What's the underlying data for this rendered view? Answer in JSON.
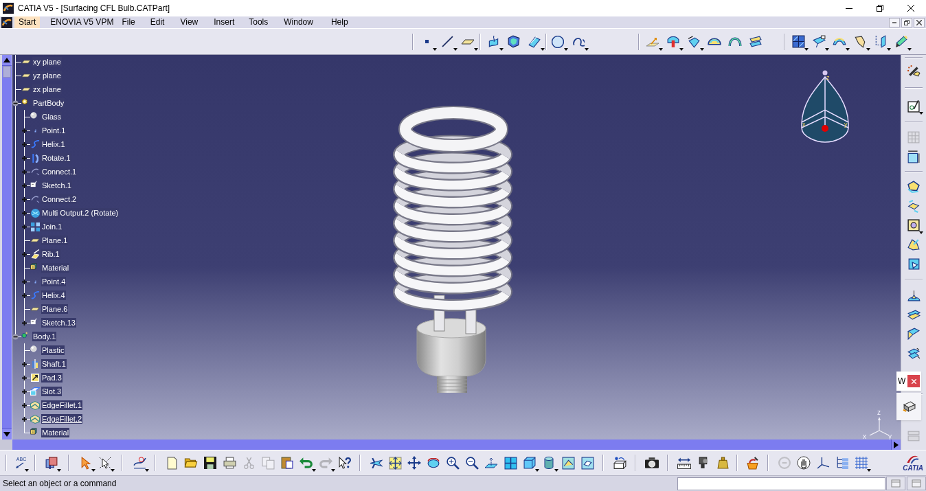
{
  "window": {
    "title": "CATIA V5 - [Surfacing CFL Bulb.CATPart]"
  },
  "menu_bar": {
    "items": [
      {
        "label": "Start",
        "selected": true
      },
      {
        "label": "ENOVIA V5 VPM",
        "selected": false
      },
      {
        "label": "File",
        "selected": false
      },
      {
        "label": "Edit",
        "selected": false
      },
      {
        "label": "View",
        "selected": false
      },
      {
        "label": "Insert",
        "selected": false
      },
      {
        "label": "Tools",
        "selected": false
      },
      {
        "label": "Window",
        "selected": false
      },
      {
        "label": "Help",
        "selected": false
      }
    ]
  },
  "top_toolbar": {
    "groups": [
      [
        {
          "kind": "point",
          "dropdown": true,
          "disabled": false
        },
        {
          "kind": "line",
          "dropdown": true,
          "disabled": false
        },
        {
          "kind": "plane",
          "dropdown": true,
          "disabled": false
        }
      ],
      [
        {
          "kind": "sweep",
          "dropdown": true,
          "disabled": false
        },
        {
          "kind": "patch",
          "dropdown": false,
          "disabled": false
        },
        {
          "kind": "extrude",
          "dropdown": true,
          "disabled": false
        }
      ],
      [
        {
          "kind": "circle",
          "dropdown": true,
          "disabled": false
        },
        {
          "kind": "spline",
          "dropdown": true,
          "disabled": false
        }
      ],
      [
        {
          "kind": "offset",
          "dropdown": true,
          "disabled": false
        },
        {
          "kind": "split",
          "dropdown": true,
          "disabled": false
        },
        {
          "kind": "flip",
          "dropdown": true,
          "disabled": false
        },
        {
          "kind": "dome",
          "dropdown": false,
          "disabled": false
        },
        {
          "kind": "arch",
          "dropdown": false,
          "disabled": false
        },
        {
          "kind": "stack",
          "dropdown": false,
          "disabled": false
        }
      ],
      [
        {
          "kind": "quad",
          "dropdown": true,
          "disabled": false
        },
        {
          "kind": "wedge",
          "dropdown": true,
          "disabled": false
        },
        {
          "kind": "arc",
          "dropdown": true,
          "disabled": false
        },
        {
          "kind": "bend",
          "dropdown": true,
          "disabled": false
        },
        {
          "kind": "project",
          "dropdown": true,
          "disabled": false
        },
        {
          "kind": "pencil",
          "dropdown": true,
          "disabled": false
        }
      ]
    ]
  },
  "specification_tree": [
    {
      "label": "xy plane",
      "kind": "plane",
      "expandable": false,
      "in_work": false
    },
    {
      "label": "yz plane",
      "kind": "plane",
      "expandable": false,
      "in_work": false
    },
    {
      "label": "zx plane",
      "kind": "plane",
      "expandable": false,
      "in_work": false
    },
    {
      "label": "PartBody",
      "kind": "body",
      "expandable": true,
      "expanded": true,
      "in_work": false,
      "children": [
        {
          "label": "Glass",
          "kind": "sphere",
          "expandable": false,
          "in_work": false
        },
        {
          "label": "Point.1",
          "kind": "point",
          "expandable": true,
          "expanded": false,
          "in_work": false
        },
        {
          "label": "Helix.1",
          "kind": "helix",
          "expandable": true,
          "expanded": false,
          "in_work": false
        },
        {
          "label": "Rotate.1",
          "kind": "rotate",
          "expandable": true,
          "expanded": false,
          "in_work": false
        },
        {
          "label": "Connect.1",
          "kind": "connect",
          "expandable": true,
          "expanded": false,
          "in_work": false
        },
        {
          "label": "Sketch.1",
          "kind": "sketch",
          "expandable": true,
          "expanded": false,
          "in_work": false
        },
        {
          "label": "Connect.2",
          "kind": "connect",
          "expandable": true,
          "expanded": false,
          "in_work": false
        },
        {
          "label": "Multi Output.2 (Rotate)",
          "kind": "multi",
          "expandable": true,
          "expanded": false,
          "in_work": false
        },
        {
          "label": "Join.1",
          "kind": "join",
          "expandable": true,
          "expanded": false,
          "in_work": false
        },
        {
          "label": "Plane.1",
          "kind": "plane",
          "expandable": false,
          "in_work": false
        },
        {
          "label": "Rib.1",
          "kind": "rib",
          "expandable": true,
          "expanded": false,
          "in_work": false
        },
        {
          "label": "Material",
          "kind": "material",
          "expandable": false,
          "in_work": false
        },
        {
          "label": "Point.4",
          "kind": "point",
          "expandable": true,
          "expanded": false,
          "in_work": false
        },
        {
          "label": "Helix.4",
          "kind": "helix",
          "expandable": true,
          "expanded": false,
          "in_work": false
        },
        {
          "label": "Plane.6",
          "kind": "plane",
          "expandable": false,
          "in_work": false
        },
        {
          "label": "Sketch.13",
          "kind": "sketch",
          "expandable": true,
          "expanded": false,
          "in_work": false
        }
      ]
    },
    {
      "label": "Body.1",
      "kind": "body_alt",
      "expandable": true,
      "expanded": true,
      "in_work": false,
      "children": [
        {
          "label": "Plastic",
          "kind": "sphere",
          "expandable": false,
          "in_work": false
        },
        {
          "label": "Shaft.1",
          "kind": "shaft",
          "expandable": true,
          "expanded": false,
          "in_work": false
        },
        {
          "label": "Pad.3",
          "kind": "pad",
          "expandable": true,
          "expanded": false,
          "in_work": false
        },
        {
          "label": "Slot.3",
          "kind": "slot",
          "expandable": true,
          "expanded": false,
          "in_work": false
        },
        {
          "label": "EdgeFillet.1",
          "kind": "fillet",
          "expandable": true,
          "expanded": false,
          "in_work": false
        },
        {
          "label": "EdgeFillet.2",
          "kind": "fillet",
          "expandable": true,
          "expanded": false,
          "in_work": true
        },
        {
          "label": "Material",
          "kind": "material",
          "expandable": false,
          "in_work": false
        }
      ]
    }
  ],
  "viewport": {
    "compass_labels": [
      "z",
      "x",
      "y"
    ],
    "axis_labels": [
      "z",
      "x",
      "y"
    ]
  },
  "right_toolbar": {
    "groups": [
      [
        {
          "kind": "wand",
          "dropdown": false,
          "disabled": false
        }
      ],
      [
        {
          "kind": "sketchpad",
          "dropdown": true,
          "disabled": false
        }
      ],
      [
        {
          "kind": "table",
          "dropdown": false,
          "disabled": true
        },
        {
          "kind": "frame",
          "dropdown": false,
          "disabled": false
        }
      ],
      [
        {
          "kind": "prism",
          "dropdown": false,
          "disabled": false
        },
        {
          "kind": "pocket",
          "dropdown": false,
          "disabled": false
        },
        {
          "kind": "hole",
          "dropdown": true,
          "disabled": false
        },
        {
          "kind": "shaft",
          "dropdown": false,
          "disabled": false
        },
        {
          "kind": "groove",
          "dropdown": false,
          "disabled": false
        }
      ],
      [
        {
          "kind": "draft",
          "dropdown": false,
          "disabled": false
        },
        {
          "kind": "rib",
          "dropdown": false,
          "disabled": false
        },
        {
          "kind": "slot",
          "dropdown": false,
          "disabled": false
        },
        {
          "kind": "splitplate",
          "dropdown": false,
          "disabled": false
        }
      ],
      [
        {
          "kind": "stackpanel",
          "dropdown": false,
          "disabled": true
        }
      ]
    ]
  },
  "notification": {
    "text": "W"
  },
  "floating_toolbar": {
    "items": [
      {
        "kind": "boxtool",
        "dropdown": false,
        "disabled": false
      }
    ]
  },
  "bottom_toolbar": {
    "groups": [
      [
        {
          "kind": "annotation",
          "label": "ABC",
          "dropdown": true,
          "disabled": false
        }
      ],
      [
        {
          "kind": "cubes",
          "dropdown": true,
          "disabled": false
        }
      ],
      [
        {
          "kind": "pointer",
          "dropdown": true,
          "disabled": false
        },
        {
          "kind": "trap",
          "dropdown": true,
          "disabled": false
        }
      ],
      [
        {
          "kind": "curve",
          "dropdown": true,
          "disabled": false
        }
      ],
      [
        {
          "kind": "new",
          "dropdown": false,
          "disabled": false
        },
        {
          "kind": "open",
          "dropdown": false,
          "disabled": false
        },
        {
          "kind": "save",
          "dropdown": false,
          "disabled": false
        },
        {
          "kind": "print",
          "dropdown": false,
          "disabled": false
        },
        {
          "kind": "cut",
          "dropdown": false,
          "disabled": true
        },
        {
          "kind": "copy",
          "dropdown": false,
          "disabled": true
        },
        {
          "kind": "paste",
          "dropdown": false,
          "disabled": false
        },
        {
          "kind": "undo",
          "dropdown": true,
          "disabled": false
        },
        {
          "kind": "redo",
          "dropdown": true,
          "disabled": true
        },
        {
          "kind": "help",
          "dropdown": false,
          "disabled": false
        }
      ],
      [
        {
          "kind": "fly",
          "dropdown": false,
          "disabled": false
        },
        {
          "kind": "fit",
          "dropdown": false,
          "disabled": false
        },
        {
          "kind": "pan",
          "dropdown": false,
          "disabled": false
        },
        {
          "kind": "rotateview",
          "dropdown": false,
          "disabled": false
        },
        {
          "kind": "zoomin",
          "dropdown": false,
          "disabled": false
        },
        {
          "kind": "zoomout",
          "dropdown": false,
          "disabled": false
        },
        {
          "kind": "normal",
          "dropdown": false,
          "disabled": false
        },
        {
          "kind": "quad4",
          "dropdown": false,
          "disabled": false
        },
        {
          "kind": "cube",
          "dropdown": true,
          "disabled": false
        },
        {
          "kind": "cylinder",
          "dropdown": true,
          "disabled": false
        },
        {
          "kind": "image",
          "dropdown": false,
          "disabled": false
        },
        {
          "kind": "swap",
          "dropdown": false,
          "disabled": false
        }
      ],
      [
        {
          "kind": "scene",
          "dropdown": false,
          "disabled": false
        }
      ],
      [
        {
          "kind": "camera",
          "dropdown": false,
          "disabled": false
        }
      ],
      [
        {
          "kind": "ruler",
          "dropdown": false,
          "disabled": false
        },
        {
          "kind": "caliper",
          "dropdown": false,
          "disabled": false
        },
        {
          "kind": "weight",
          "dropdown": false,
          "disabled": false
        }
      ],
      [
        {
          "kind": "apply",
          "dropdown": false,
          "disabled": false
        }
      ],
      [
        {
          "kind": "refresh",
          "dropdown": false,
          "disabled": true
        },
        {
          "kind": "hand",
          "dropdown": false,
          "disabled": false
        },
        {
          "kind": "axis",
          "dropdown": false,
          "disabled": false
        },
        {
          "kind": "tree",
          "dropdown": false,
          "disabled": false
        },
        {
          "kind": "grid",
          "dropdown": true,
          "disabled": false
        }
      ]
    ]
  },
  "logo": {
    "text": "CATIA"
  },
  "status_bar": {
    "message": "Select an object or a command"
  }
}
